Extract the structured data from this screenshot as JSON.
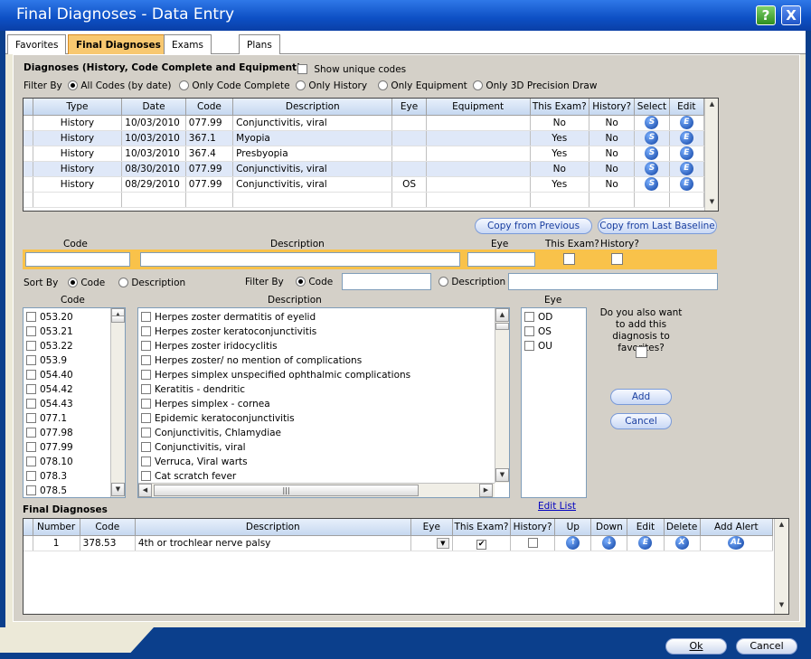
{
  "window": {
    "title": "Final Diagnoses - Data Entry",
    "help_icon": "?",
    "close_icon": "X"
  },
  "tabs": [
    "Favorites",
    "Final Diagnoses",
    "Exams",
    "Plans"
  ],
  "diag_section": {
    "title": "Diagnoses (History, Code Complete and Equipment)",
    "show_unique": "Show unique codes",
    "filter_by": "Filter By",
    "filters": [
      "All Codes (by date)",
      "Only Code Complete",
      "Only History",
      "Only Equipment",
      "Only 3D Precision Draw"
    ]
  },
  "history_table": {
    "columns": [
      "Type",
      "Date",
      "Code",
      "Description",
      "Eye",
      "Equipment",
      "This Exam?",
      "History?",
      "Select",
      "Edit"
    ],
    "rows": [
      [
        "History",
        "10/03/2010",
        "077.99",
        "Conjunctivitis, viral",
        "",
        "",
        "No",
        "No"
      ],
      [
        "History",
        "10/03/2010",
        "367.1",
        "Myopia",
        "",
        "",
        "Yes",
        "No"
      ],
      [
        "History",
        "10/03/2010",
        "367.4",
        "Presbyopia",
        "",
        "",
        "Yes",
        "No"
      ],
      [
        "History",
        "08/30/2010",
        "077.99",
        "Conjunctivitis, viral",
        "",
        "",
        "No",
        "No"
      ],
      [
        "History",
        "08/29/2010",
        "077.99",
        "Conjunctivitis, viral",
        "OS",
        "",
        "Yes",
        "No"
      ]
    ]
  },
  "select_icon": "S",
  "edit_icon": "E",
  "copy_prev": "Copy from Previous",
  "copy_baseline": "Copy from Last Baseline",
  "entry": {
    "code": "Code",
    "description": "Description",
    "eye": "Eye",
    "this_exam": "This Exam?",
    "history": "History?"
  },
  "sort": {
    "label": "Sort By",
    "code": "Code",
    "description": "Description"
  },
  "filter2": {
    "label": "Filter By",
    "code": "Code",
    "description": "Description"
  },
  "list_headers": {
    "code": "Code",
    "description": "Description",
    "eye": "Eye"
  },
  "codes": [
    "053.20",
    "053.21",
    "053.22",
    "053.9",
    "054.40",
    "054.42",
    "054.43",
    "077.1",
    "077.98",
    "077.99",
    "078.10",
    "078.3",
    "078.5"
  ],
  "descriptions": [
    "Herpes zoster dermatitis of eyelid",
    "Herpes zoster keratoconjunctivitis",
    "Herpes zoster iridocyclitis",
    "Herpes zoster/ no mention of complications",
    "Herpes simplex unspecified ophthalmic complications",
    "Keratitis - dendritic",
    "Herpes simplex - cornea",
    "Epidemic keratoconjunctivitis",
    "Conjunctivitis, Chlamydiae",
    "Conjunctivitis, viral",
    "Verruca, Viral warts",
    "Cat scratch fever"
  ],
  "eyes": [
    "OD",
    "OS",
    "OU"
  ],
  "favorites_q": "Do you also want to add this diagnosis to favorites?",
  "add": "Add",
  "cancel_small": "Cancel",
  "edit_list": "Edit List",
  "final": {
    "title": "Final Diagnoses",
    "columns": [
      "Number",
      "Code",
      "Description",
      "Eye",
      "This Exam?",
      "History?",
      "Up",
      "Down",
      "Edit",
      "Delete",
      "Add Alert"
    ],
    "row": {
      "number": "1",
      "code": "378.53",
      "description": "4th or trochlear nerve palsy"
    }
  },
  "alert_icon": "AL",
  "delete_icon": "X",
  "up_icon": "↑",
  "down_icon": "↓",
  "ok": "Ok",
  "cancel": "Cancel"
}
